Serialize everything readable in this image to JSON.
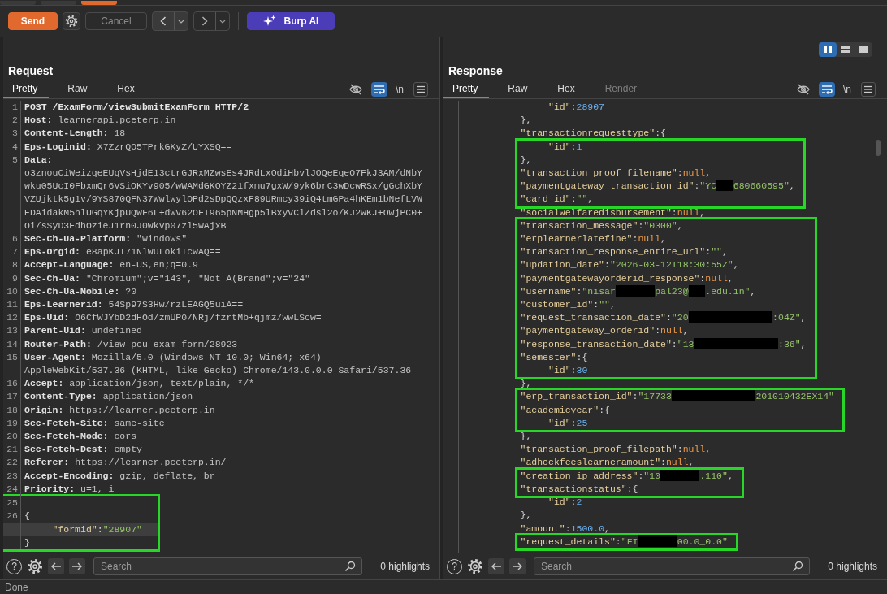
{
  "top_tabs": [
    {
      "selected": false
    },
    {
      "selected": false
    },
    {
      "selected": true
    }
  ],
  "toolbar": {
    "send": "Send",
    "cancel": {
      "label": "Cancel",
      "disabled": true
    },
    "back": {
      "disabled": false
    },
    "forward": {
      "disabled": true
    },
    "burp_ai": "Burp AI"
  },
  "request": {
    "title": "Request",
    "tabs": [
      {
        "label": "Pretty",
        "selected": true,
        "disabled": false
      },
      {
        "label": "Raw",
        "selected": false,
        "disabled": false
      },
      {
        "label": "Hex",
        "selected": false,
        "disabled": false
      }
    ],
    "wrap_on": true,
    "newline_toggle": "\\n",
    "sections": [
      {
        "highlighted": false,
        "lines": [
          {
            "number": "1",
            "kind": "start",
            "text": "POST /ExamForm/viewSubmitExamForm HTTP/2",
            "current": false
          },
          {
            "number": "2",
            "kind": "header",
            "name": "Host:",
            "value": "learnerapi.pceterp.in",
            "current": false
          },
          {
            "number": "3",
            "kind": "header",
            "name": "Content-Length:",
            "value": "18",
            "current": false
          },
          {
            "number": "4",
            "kind": "header",
            "name": "Eps-Loginid:",
            "value": "X7ZzrQO5TPrkGKyZ/UYXSQ==",
            "current": false
          },
          {
            "number": "5",
            "kind": "header",
            "name": "Data:",
            "value": "o3znouCiWeizqeEUqVsHjdE13ctrGJRxMZwsEs4JRdLxOdiHbvlJOQeEqeO7FkJ3AM/dNbYwku05UcI0FbxmQr6VSiOKYv905/wWAMdGKOYZ21fxmu7gxW/9yk6brC3wDcwRSx/gGchXbYVZUjktk5g1v/9YS870QFN37WwlwylOPd2sDpQQzxF89URmcy39iQ4tmGPa4hKEm1bNefLVWEDAidakM5hlUGqYKjpUQWF6L+dWV62OFI965pNMHgp5lBxyvClZdsl2o/KJ2wKJ+OwjPC0+Oi/sSyD3EdhOzieJ1rn0J0WkVp07zl5WAjxB",
            "current": false
          },
          {
            "number": "6",
            "kind": "header",
            "name": "Sec-Ch-Ua-Platform:",
            "value": "\"Windows\"",
            "current": false
          },
          {
            "number": "7",
            "kind": "header",
            "name": "Eps-Orgid:",
            "value": "e8apKJI71NlWULokiTcwAQ==",
            "current": false
          },
          {
            "number": "8",
            "kind": "header",
            "name": "Accept-Language:",
            "value": "en-US,en;q=0.9",
            "current": false
          },
          {
            "number": "9",
            "kind": "header",
            "name": "Sec-Ch-Ua:",
            "value": "\"Chromium\";v=\"143\", \"Not A(Brand\";v=\"24\"",
            "current": false
          },
          {
            "number": "10",
            "kind": "header",
            "name": "Sec-Ch-Ua-Mobile:",
            "value": "?0",
            "current": false
          },
          {
            "number": "11",
            "kind": "header",
            "name": "Eps-Learnerid:",
            "value": "54Sp97S3Hw/rzLEAGQ5uiA==",
            "current": false
          },
          {
            "number": "12",
            "kind": "header",
            "name": "Eps-Uid:",
            "value": "O6CfWJYbD2dHOd/zmUP0/NRj/fzrtMb+qjmz/wwLScw=",
            "current": false
          },
          {
            "number": "13",
            "kind": "header",
            "name": "Parent-Uid:",
            "value": "undefined",
            "current": false
          },
          {
            "number": "14",
            "kind": "header",
            "name": "Router-Path:",
            "value": "/view-pcu-exam-form/28923",
            "current": false
          },
          {
            "number": "15",
            "kind": "header",
            "name": "User-Agent:",
            "value": "Mozilla/5.0 (Windows NT 10.0; Win64; x64) AppleWebKit/537.36 (KHTML, like Gecko) Chrome/143.0.0.0 Safari/537.36",
            "current": false
          },
          {
            "number": "16",
            "kind": "header",
            "name": "Accept:",
            "value": "application/json, text/plain, */*",
            "current": false
          },
          {
            "number": "17",
            "kind": "header",
            "name": "Content-Type:",
            "value": "application/json",
            "current": false
          },
          {
            "number": "18",
            "kind": "header",
            "name": "Origin:",
            "value": "https://learner.pceterp.in",
            "current": false
          },
          {
            "number": "19",
            "kind": "header",
            "name": "Sec-Fetch-Site:",
            "value": "same-site",
            "current": false
          },
          {
            "number": "20",
            "kind": "header",
            "name": "Sec-Fetch-Mode:",
            "value": "cors",
            "current": false
          },
          {
            "number": "21",
            "kind": "header",
            "name": "Sec-Fetch-Dest:",
            "value": "empty",
            "current": false
          },
          {
            "number": "22",
            "kind": "header",
            "name": "Referer:",
            "value": "https://learner.pceterp.in/",
            "current": false
          },
          {
            "number": "23",
            "kind": "header",
            "name": "Accept-Encoding:",
            "value": "gzip, deflate, br",
            "current": false
          },
          {
            "number": "24",
            "kind": "header",
            "name": "Priority:",
            "value": "u=1, i",
            "current": false
          }
        ]
      },
      {
        "highlighted": true,
        "lines": [
          {
            "number": "25",
            "kind": "json",
            "current": false
          },
          {
            "number": "26",
            "kind": "json",
            "parts": [
              {
                "kind": "punct",
                "text": "{"
              }
            ],
            "current": false
          },
          {
            "kind": "json_member",
            "parts": [
              {
                "kind": "key",
                "text": "\"formid\""
              },
              {
                "kind": "punct",
                "text": ":"
              },
              {
                "kind": "string",
                "text": "\"28907\""
              }
            ],
            "current": true
          },
          {
            "kind": "json",
            "parts": [
              {
                "kind": "punct",
                "text": "}"
              }
            ],
            "current": false
          }
        ]
      }
    ],
    "search_placeholder": "Search",
    "highlights": "0 highlights",
    "help": "?"
  },
  "response": {
    "title": "Response",
    "layout_modes": [
      {
        "kind": "columns",
        "selected": true
      },
      {
        "kind": "rows",
        "selected": false
      },
      {
        "kind": "single",
        "selected": false
      }
    ],
    "tabs": [
      {
        "label": "Pretty",
        "selected": true,
        "disabled": false
      },
      {
        "label": "Raw",
        "selected": false,
        "disabled": false
      },
      {
        "label": "Hex",
        "selected": false,
        "disabled": false
      },
      {
        "label": "Render",
        "selected": false,
        "disabled": true
      }
    ],
    "wrap_on": true,
    "newline_toggle": "\\n",
    "sections": [
      {
        "highlighted": false,
        "lines": [
          {
            "kind": "inner_member",
            "parts": [
              {
                "kind": "key",
                "text": "\"id\""
              },
              {
                "kind": "punct",
                "text": ":"
              },
              {
                "kind": "number",
                "text": "28907"
              }
            ]
          },
          {
            "kind": "member",
            "parts": [
              {
                "kind": "punct",
                "text": "},"
              }
            ]
          },
          {
            "kind": "member",
            "parts": [
              {
                "kind": "key",
                "text": "\"transactionrequesttype\""
              },
              {
                "kind": "punct",
                "text": ":{"
              }
            ]
          }
        ]
      },
      {
        "highlighted": true,
        "lines": [
          {
            "kind": "inner_member",
            "parts": [
              {
                "kind": "key",
                "text": "\"id\""
              },
              {
                "kind": "punct",
                "text": ":"
              },
              {
                "kind": "number",
                "text": "1"
              }
            ]
          },
          {
            "kind": "member",
            "parts": [
              {
                "kind": "punct",
                "text": "},"
              }
            ]
          },
          {
            "kind": "member",
            "parts": [
              {
                "kind": "key",
                "text": "\"transaction_proof_filename\""
              },
              {
                "kind": "punct",
                "text": ":"
              },
              {
                "kind": "null",
                "text": "null"
              },
              {
                "kind": "punct",
                "text": ","
              }
            ]
          },
          {
            "kind": "member",
            "parts": [
              {
                "kind": "key",
                "text": "\"paymentgateway_transaction_id\""
              },
              {
                "kind": "punct",
                "text": ":"
              },
              {
                "kind": "string",
                "text": "\"YC"
              },
              {
                "kind": "redacted_short"
              },
              {
                "kind": "string",
                "text": "680660595\""
              },
              {
                "kind": "punct",
                "text": ","
              }
            ]
          },
          {
            "kind": "member",
            "parts": [
              {
                "kind": "key",
                "text": "\"card_id\""
              },
              {
                "kind": "punct",
                "text": ":"
              },
              {
                "kind": "string",
                "text": "\"\""
              },
              {
                "kind": "punct",
                "text": ","
              }
            ]
          }
        ]
      },
      {
        "highlighted": false,
        "lines": [
          {
            "kind": "member",
            "parts": [
              {
                "kind": "key",
                "text": "\"socialwelfaredisbursement\""
              },
              {
                "kind": "punct",
                "text": ":"
              },
              {
                "kind": "null",
                "text": "null"
              },
              {
                "kind": "punct",
                "text": ","
              }
            ]
          }
        ]
      },
      {
        "highlighted": true,
        "lines": [
          {
            "kind": "member",
            "parts": [
              {
                "kind": "key",
                "text": "\"transaction_message\""
              },
              {
                "kind": "punct",
                "text": ":"
              },
              {
                "kind": "string",
                "text": "\"0300\""
              },
              {
                "kind": "punct",
                "text": ","
              }
            ]
          },
          {
            "kind": "member",
            "parts": [
              {
                "kind": "key",
                "text": "\"erplearnerlatefine\""
              },
              {
                "kind": "punct",
                "text": ":"
              },
              {
                "kind": "null",
                "text": "null"
              },
              {
                "kind": "punct",
                "text": ","
              }
            ]
          },
          {
            "kind": "member",
            "parts": [
              {
                "kind": "key",
                "text": "\"transaction_response_entire_url\""
              },
              {
                "kind": "punct",
                "text": ":"
              },
              {
                "kind": "string",
                "text": "\"\""
              },
              {
                "kind": "punct",
                "text": ","
              }
            ]
          },
          {
            "kind": "member",
            "parts": [
              {
                "kind": "key",
                "text": "\"updation_date\""
              },
              {
                "kind": "punct",
                "text": ":"
              },
              {
                "kind": "string",
                "text": "\"2026-03-12T18:30:55Z\""
              },
              {
                "kind": "punct",
                "text": ","
              }
            ]
          },
          {
            "kind": "member",
            "parts": [
              {
                "kind": "key",
                "text": "\"paymentgatewayorderid_response\""
              },
              {
                "kind": "punct",
                "text": ":"
              },
              {
                "kind": "null",
                "text": "null"
              },
              {
                "kind": "punct",
                "text": ","
              }
            ]
          },
          {
            "kind": "member",
            "parts": [
              {
                "kind": "key",
                "text": "\"username\""
              },
              {
                "kind": "punct",
                "text": ":"
              },
              {
                "kind": "string",
                "text": "\"nisar"
              },
              {
                "kind": "redacted_medium"
              },
              {
                "kind": "string",
                "text": "pal23@"
              },
              {
                "kind": "redacted_short"
              },
              {
                "kind": "string",
                "text": ".edu.in\""
              },
              {
                "kind": "punct",
                "text": ","
              }
            ]
          },
          {
            "kind": "member",
            "parts": [
              {
                "kind": "key",
                "text": "\"customer_id\""
              },
              {
                "kind": "punct",
                "text": ":"
              },
              {
                "kind": "string",
                "text": "\"\""
              },
              {
                "kind": "punct",
                "text": ","
              }
            ]
          },
          {
            "kind": "member",
            "parts": [
              {
                "kind": "key",
                "text": "\"request_transaction_date\""
              },
              {
                "kind": "punct",
                "text": ":"
              },
              {
                "kind": "string",
                "text": "\"20"
              },
              {
                "kind": "redacted_long"
              },
              {
                "kind": "string",
                "text": ":04Z\""
              },
              {
                "kind": "punct",
                "text": ","
              }
            ]
          },
          {
            "kind": "member",
            "parts": [
              {
                "kind": "key",
                "text": "\"paymentgateway_orderid\""
              },
              {
                "kind": "punct",
                "text": ":"
              },
              {
                "kind": "null",
                "text": "null"
              },
              {
                "kind": "punct",
                "text": ","
              }
            ]
          },
          {
            "kind": "member",
            "parts": [
              {
                "kind": "key",
                "text": "\"response_transaction_date\""
              },
              {
                "kind": "punct",
                "text": ":"
              },
              {
                "kind": "string",
                "text": "\"13"
              },
              {
                "kind": "redacted_long"
              },
              {
                "kind": "string",
                "text": ":36\""
              },
              {
                "kind": "punct",
                "text": ","
              }
            ]
          },
          {
            "kind": "member",
            "parts": [
              {
                "kind": "key",
                "text": "\"semester\""
              },
              {
                "kind": "punct",
                "text": ":{"
              }
            ]
          },
          {
            "kind": "inner_member",
            "parts": [
              {
                "kind": "key",
                "text": "\"id\""
              },
              {
                "kind": "punct",
                "text": ":"
              },
              {
                "kind": "number",
                "text": "30"
              }
            ]
          }
        ]
      },
      {
        "highlighted": false,
        "lines": [
          {
            "kind": "member",
            "parts": [
              {
                "kind": "punct",
                "text": "},"
              }
            ]
          }
        ]
      },
      {
        "highlighted": true,
        "lines": [
          {
            "kind": "member",
            "parts": [
              {
                "kind": "key",
                "text": "\"erp_transaction_id\""
              },
              {
                "kind": "punct",
                "text": ":"
              },
              {
                "kind": "string",
                "text": "\"17733"
              },
              {
                "kind": "redacted_long"
              },
              {
                "kind": "string",
                "text": "201010432EX14\""
              }
            ]
          },
          {
            "kind": "member",
            "parts": [
              {
                "kind": "key",
                "text": "\"academicyear\""
              },
              {
                "kind": "punct",
                "text": ":{"
              }
            ]
          },
          {
            "kind": "inner_member",
            "parts": [
              {
                "kind": "key",
                "text": "\"id\""
              },
              {
                "kind": "punct",
                "text": ":"
              },
              {
                "kind": "number",
                "text": "25"
              }
            ]
          }
        ]
      },
      {
        "highlighted": false,
        "lines": [
          {
            "kind": "member",
            "parts": [
              {
                "kind": "punct",
                "text": "},"
              }
            ]
          },
          {
            "kind": "member",
            "parts": [
              {
                "kind": "key",
                "text": "\"transaction_proof_filepath\""
              },
              {
                "kind": "punct",
                "text": ":"
              },
              {
                "kind": "null",
                "text": "null"
              },
              {
                "kind": "punct",
                "text": ","
              }
            ]
          },
          {
            "kind": "member",
            "parts": [
              {
                "kind": "key",
                "text": "\"adhockfeeslearneramount\""
              },
              {
                "kind": "punct",
                "text": ":"
              },
              {
                "kind": "null",
                "text": "null"
              },
              {
                "kind": "punct",
                "text": ","
              }
            ]
          }
        ]
      },
      {
        "highlighted": true,
        "lines": [
          {
            "kind": "member",
            "parts": [
              {
                "kind": "key",
                "text": "\"creation_ip_address\""
              },
              {
                "kind": "punct",
                "text": ":"
              },
              {
                "kind": "string",
                "text": "\"10"
              },
              {
                "kind": "redacted_medium"
              },
              {
                "kind": "string",
                "text": ".110\""
              },
              {
                "kind": "punct",
                "text": ","
              }
            ]
          },
          {
            "kind": "member",
            "parts": [
              {
                "kind": "key",
                "text": "\"transactionstatus\""
              },
              {
                "kind": "punct",
                "text": ":{"
              }
            ]
          }
        ]
      },
      {
        "highlighted": false,
        "lines": [
          {
            "kind": "inner_member",
            "parts": [
              {
                "kind": "key",
                "text": "\"id\""
              },
              {
                "kind": "punct",
                "text": ":"
              },
              {
                "kind": "number",
                "text": "2"
              }
            ]
          },
          {
            "kind": "member",
            "parts": [
              {
                "kind": "punct",
                "text": "},"
              }
            ]
          },
          {
            "kind": "member",
            "parts": [
              {
                "kind": "key",
                "text": "\"amount\""
              },
              {
                "kind": "punct",
                "text": ":"
              },
              {
                "kind": "number",
                "text": "1500.0"
              },
              {
                "kind": "punct",
                "text": ","
              }
            ]
          }
        ]
      },
      {
        "highlighted": true,
        "lines": [
          {
            "kind": "member",
            "parts": [
              {
                "kind": "key",
                "text": "\"request_details\""
              },
              {
                "kind": "punct",
                "text": ":"
              },
              {
                "kind": "string",
                "text": "\"FI"
              },
              {
                "kind": "redacted_medium"
              },
              {
                "kind": "string",
                "text": "00.0_0.0\""
              }
            ]
          }
        ]
      }
    ],
    "search_placeholder": "Search",
    "highlights": "0 highlights",
    "help": "?"
  },
  "status_bar": "Done"
}
